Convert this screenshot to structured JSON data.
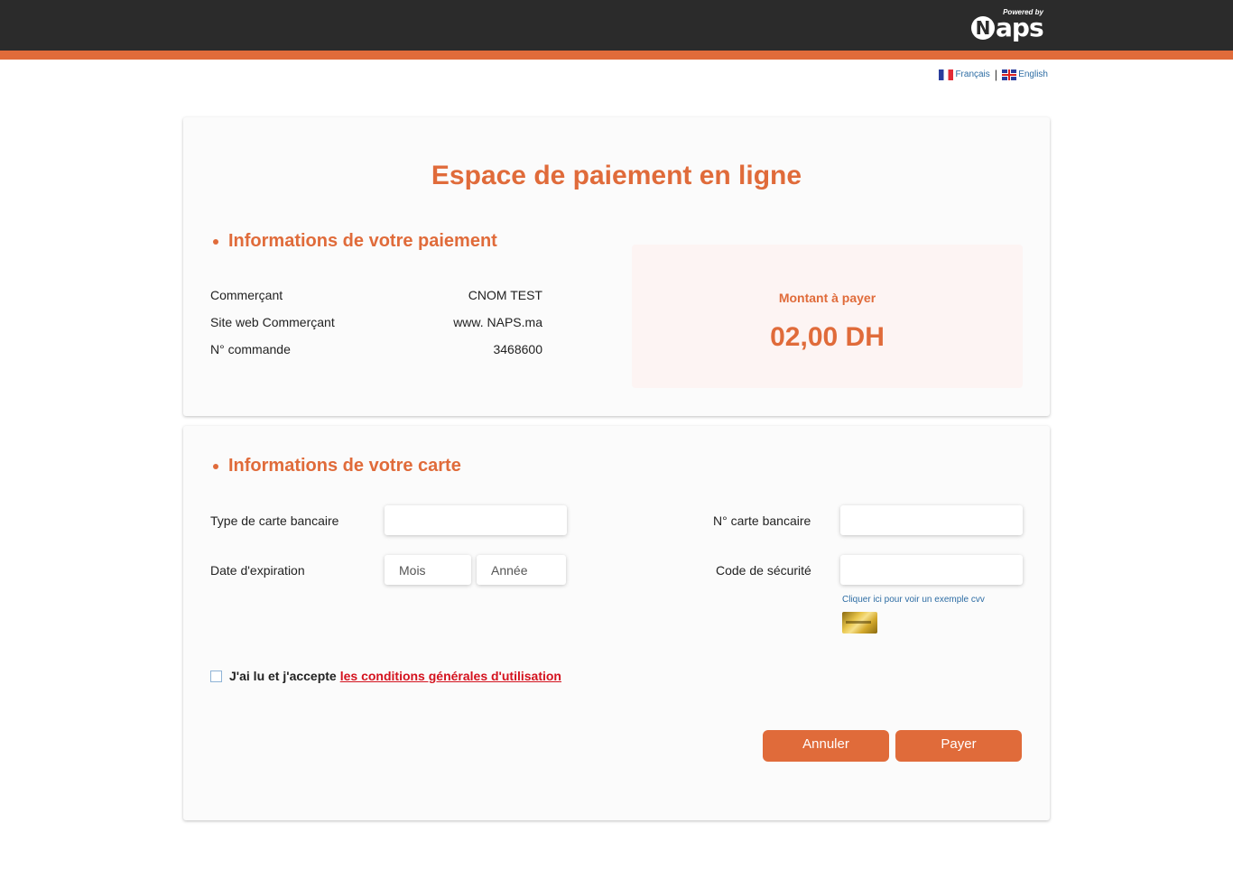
{
  "header": {
    "powered_by": "Powered by",
    "logo_letter": "N",
    "logo_rest": "aps",
    "brand_colors": {
      "dark": "#2b2b2b",
      "accent": "#e06b3a"
    }
  },
  "language": {
    "french": "Français",
    "separator": "|",
    "english": "English"
  },
  "page_title": "Espace de paiement en ligne",
  "payment_info": {
    "section_title": "Informations de votre paiement",
    "rows": [
      {
        "label": "Commerçant",
        "value": "CNOM TEST"
      },
      {
        "label": "Site web Commerçant",
        "value": "www. NAPS.ma"
      },
      {
        "label": "N° commande",
        "value": "3468600"
      }
    ],
    "amount_label": "Montant à payer",
    "amount_value": "02,00 DH"
  },
  "card_info": {
    "section_title": "Informations de votre carte",
    "card_type_label": "Type de carte bancaire",
    "card_type_value": "",
    "card_number_label": "N° carte bancaire",
    "card_number_value": "",
    "expiry_label": "Date d'expiration",
    "month_placeholder": "Mois",
    "year_placeholder": "Année",
    "cvv_label": "Code de sécurité",
    "cvv_value": "",
    "cvv_help_link": "Cliquer ici pour voir un exemple cvv"
  },
  "terms": {
    "prefix": "J'ai lu et j'accepte",
    "link": "les conditions générales d'utilisation",
    "checked": false
  },
  "actions": {
    "cancel_label": "Annuler",
    "pay_label": "Payer"
  }
}
